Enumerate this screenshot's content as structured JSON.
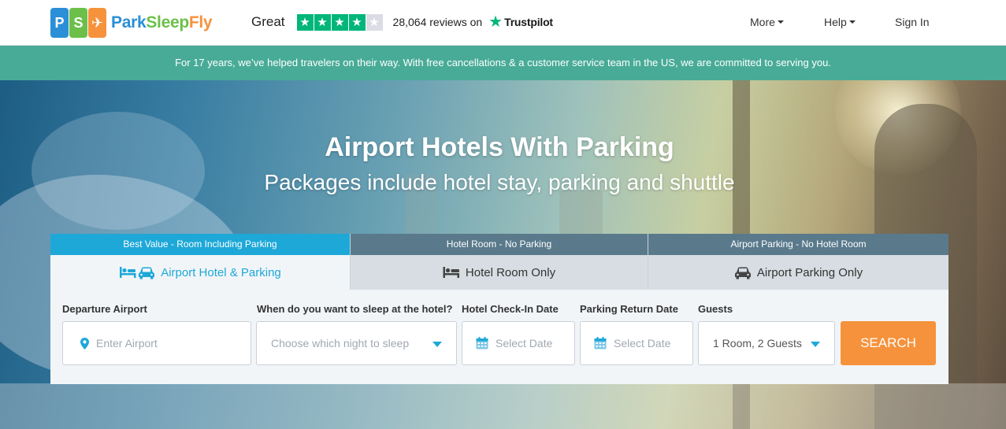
{
  "header": {
    "logo": {
      "text_park": "Park",
      "text_sleep": "Sleep",
      "text_fly": "Fly",
      "tile_p": "P",
      "tile_s": "S",
      "tile_f": "✈"
    },
    "rating": {
      "word": "Great",
      "stars_filled": 4,
      "stars_total": 5,
      "reviews_text": "28,064 reviews on",
      "provider": "Trustpilot"
    },
    "nav": {
      "more": "More",
      "help": "Help",
      "sign_in": "Sign In"
    }
  },
  "banner": {
    "text": "For 17 years, we’ve helped travelers on their way. With free cancellations & a customer service team in the US, we are committed to serving you."
  },
  "hero": {
    "title": "Airport Hotels With Parking",
    "subtitle": "Packages include hotel stay, parking and shuttle"
  },
  "search": {
    "tabs": [
      {
        "heading": "Best Value - Room Including Parking",
        "label": "Airport Hotel & Parking",
        "icon": "bed-car-icon",
        "active": true
      },
      {
        "heading": "Hotel Room - No Parking",
        "label": "Hotel Room Only",
        "icon": "bed-icon",
        "active": false
      },
      {
        "heading": "Airport Parking - No Hotel Room",
        "label": "Airport Parking Only",
        "icon": "car-icon",
        "active": false
      }
    ],
    "fields": {
      "departure": {
        "label": "Departure Airport",
        "placeholder": "Enter Airport",
        "icon": "location-pin-icon"
      },
      "night": {
        "label": "When do you want to sleep at the hotel?",
        "placeholder": "Choose which night to sleep"
      },
      "checkin": {
        "label": "Hotel Check-In Date",
        "placeholder": "Select Date",
        "icon": "calendar-icon"
      },
      "return": {
        "label": "Parking Return Date",
        "placeholder": "Select Date",
        "icon": "calendar-icon"
      },
      "guests": {
        "label": "Guests",
        "value": "1 Room, 2 Guests"
      }
    },
    "button": "SEARCH"
  },
  "colors": {
    "accent_blue": "#1da8d8",
    "banner_green": "#48ab97",
    "search_orange": "#f6923c",
    "trustpilot_green": "#00b67a"
  }
}
